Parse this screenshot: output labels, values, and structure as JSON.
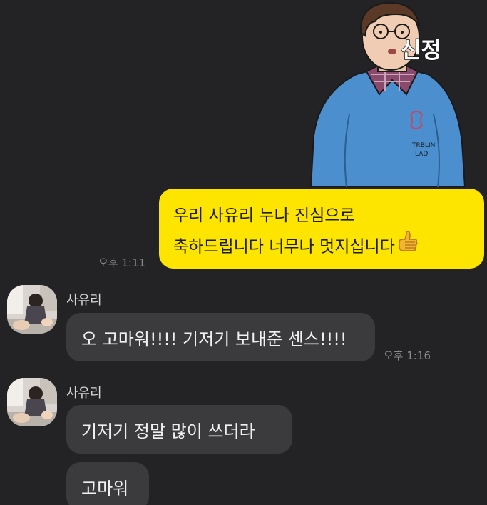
{
  "sticker": {
    "caption": "신정",
    "shirt_text_line1": "TRBLIN'",
    "shirt_text_line2": "LAD"
  },
  "outgoing": {
    "line1": "우리 사유리 누나 진심으로",
    "line2": "축하드립니다 너무나 멋지십니다",
    "emoji": "thumbs-up-icon",
    "time": "오후 1:11"
  },
  "incoming": [
    {
      "sender": "사유리",
      "messages": [
        {
          "text": "오 고마워!!!! 기저기 보내준 센스!!!!",
          "time": "오후 1:16"
        }
      ]
    },
    {
      "sender": "사유리",
      "messages": [
        {
          "text": "기저기 정말 많이 쓰더라"
        },
        {
          "text": "고마워"
        }
      ]
    }
  ],
  "colors": {
    "background": "#232325",
    "outgoing_bubble": "#fee500",
    "incoming_bubble": "#3b3b3d",
    "timestamp": "#8a8a8c"
  }
}
